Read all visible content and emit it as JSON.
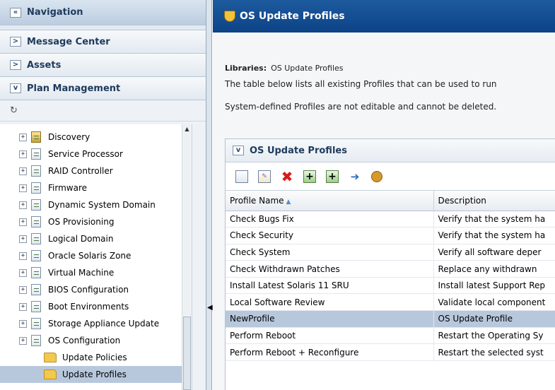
{
  "nav": {
    "title": "Navigation",
    "collapse_glyph": "«",
    "sections": [
      {
        "label": "Message Center",
        "state": "collapsed",
        "glyph": ">"
      },
      {
        "label": "Assets",
        "state": "collapsed",
        "glyph": ">"
      },
      {
        "label": "Plan Management",
        "state": "expanded",
        "glyph": "v"
      }
    ],
    "refresh_glyph": "↻"
  },
  "tree": {
    "items": [
      {
        "label": "Discovery",
        "icon": "discovery-icon"
      },
      {
        "label": "Service Processor",
        "icon": "profile-icon"
      },
      {
        "label": "RAID Controller",
        "icon": "profile-icon"
      },
      {
        "label": "Firmware",
        "icon": "profile-icon"
      },
      {
        "label": "Dynamic System Domain",
        "icon": "profile-icon"
      },
      {
        "label": "OS Provisioning",
        "icon": "profile-icon"
      },
      {
        "label": "Logical Domain",
        "icon": "profile-icon"
      },
      {
        "label": "Oracle Solaris Zone",
        "icon": "profile-icon"
      },
      {
        "label": "Virtual Machine",
        "icon": "profile-icon"
      },
      {
        "label": "BIOS Configuration",
        "icon": "profile-icon"
      },
      {
        "label": "Boot Environments",
        "icon": "profile-icon"
      },
      {
        "label": "Storage Appliance Update",
        "icon": "profile-icon"
      },
      {
        "label": "OS Configuration",
        "icon": "profile-icon"
      }
    ],
    "children": [
      {
        "label": "Update Policies",
        "icon": "folder-icon"
      },
      {
        "label": "Update Profiles",
        "icon": "folder-icon",
        "selected": true
      }
    ],
    "expander_glyph": "+"
  },
  "main": {
    "title": "OS Update Profiles",
    "libraries_label": "Libraries:",
    "libraries_value": "OS Update Profiles",
    "description_1": "The table below lists all existing Profiles that can be used to run",
    "description_2": "System-defined Profiles are not editable and cannot be deleted.",
    "panel_title": "OS Update Profiles",
    "panel_glyph": "v"
  },
  "toolbar": {
    "create": "☰",
    "edit": "✎",
    "delete": "✖",
    "copy": "+",
    "copy2": "+",
    "import": "➔",
    "export": "✦"
  },
  "table": {
    "columns": [
      "Profile Name",
      "Description"
    ],
    "sort_glyph": "▲",
    "rows": [
      {
        "name": "Check Bugs Fix",
        "desc": "Verify that the system ha"
      },
      {
        "name": "Check Security",
        "desc": "Verify that the system ha"
      },
      {
        "name": "Check System",
        "desc": "Verify all software deper"
      },
      {
        "name": "Check Withdrawn Patches",
        "desc": "Replace any withdrawn"
      },
      {
        "name": "Install Latest Solaris 11 SRU",
        "desc": "Install latest Support Rep"
      },
      {
        "name": "Local Software Review",
        "desc": "Validate local component"
      },
      {
        "name": "NewProfile",
        "desc": "OS Update Profile",
        "selected": true
      },
      {
        "name": "Perform Reboot",
        "desc": "Restart the Operating Sy"
      },
      {
        "name": "Perform Reboot + Reconfigure",
        "desc": "Restart the selected syst"
      }
    ]
  },
  "colors": {
    "header_blue": "#0d4387",
    "selection": "#b8c8dc",
    "delete_red": "#d91a1a"
  }
}
